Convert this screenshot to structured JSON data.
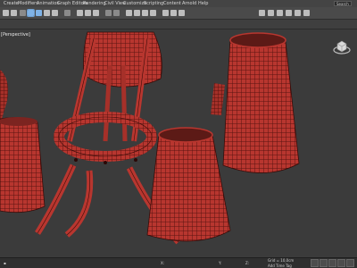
{
  "menu": {
    "items": [
      "Create",
      "Modifiers",
      "Animation",
      "Graph Editors",
      "Rendering",
      "Civil View",
      "Customize",
      "Scripting",
      "Content",
      "Arnold",
      "Help"
    ],
    "search_placeholder": "Search"
  },
  "viewport": {
    "label": "[Perspective]",
    "mesh_color": "#b8362f"
  },
  "status": {
    "x_label": "X:",
    "y_label": "Y:",
    "z_label": "Z:",
    "grid_label": "Grid = 10,0cm",
    "time_tag": "Add Time Tag"
  },
  "colors": {
    "accent": "#7fb2e6",
    "background": "#3b3b3b",
    "wire": "#5a1410"
  }
}
